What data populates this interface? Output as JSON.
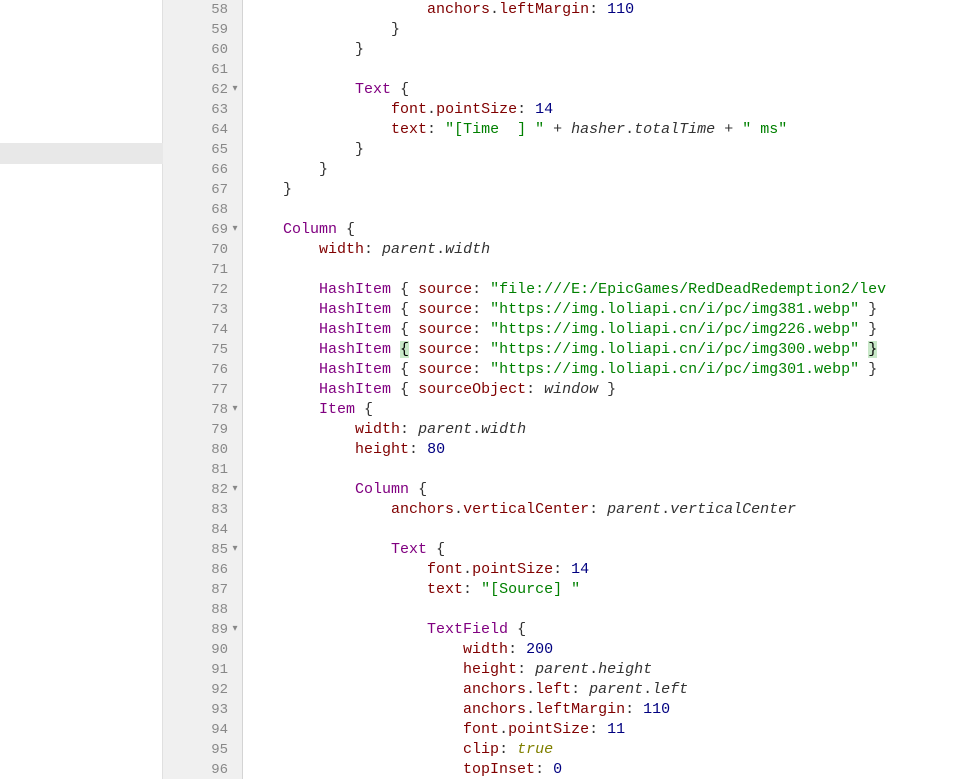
{
  "lines": [
    {
      "num": 58,
      "fold": false,
      "tokens": [
        {
          "t": "sp",
          "v": "                    "
        },
        {
          "t": "prop",
          "v": "anchors"
        },
        {
          "t": "punct",
          "v": "."
        },
        {
          "t": "prop",
          "v": "leftMargin"
        },
        {
          "t": "punct",
          "v": ": "
        },
        {
          "t": "num",
          "v": "110"
        }
      ]
    },
    {
      "num": 59,
      "fold": false,
      "tokens": [
        {
          "t": "sp",
          "v": "                "
        },
        {
          "t": "punct",
          "v": "}"
        }
      ]
    },
    {
      "num": 60,
      "fold": false,
      "tokens": [
        {
          "t": "sp",
          "v": "            "
        },
        {
          "t": "punct",
          "v": "}"
        }
      ]
    },
    {
      "num": 61,
      "fold": false,
      "tokens": []
    },
    {
      "num": 62,
      "fold": true,
      "tokens": [
        {
          "t": "sp",
          "v": "            "
        },
        {
          "t": "type",
          "v": "Text"
        },
        {
          "t": "sp",
          "v": " "
        },
        {
          "t": "punct",
          "v": "{"
        }
      ]
    },
    {
      "num": 63,
      "fold": false,
      "tokens": [
        {
          "t": "sp",
          "v": "                "
        },
        {
          "t": "prop",
          "v": "font"
        },
        {
          "t": "punct",
          "v": "."
        },
        {
          "t": "prop",
          "v": "pointSize"
        },
        {
          "t": "punct",
          "v": ": "
        },
        {
          "t": "num",
          "v": "14"
        }
      ]
    },
    {
      "num": 64,
      "fold": false,
      "tokens": [
        {
          "t": "sp",
          "v": "                "
        },
        {
          "t": "prop",
          "v": "text"
        },
        {
          "t": "punct",
          "v": ": "
        },
        {
          "t": "str",
          "v": "\"[Time  ] \""
        },
        {
          "t": "sp",
          "v": " "
        },
        {
          "t": "op",
          "v": "+"
        },
        {
          "t": "sp",
          "v": " "
        },
        {
          "t": "ident",
          "v": "hasher"
        },
        {
          "t": "punct",
          "v": "."
        },
        {
          "t": "ident",
          "v": "totalTime"
        },
        {
          "t": "sp",
          "v": " "
        },
        {
          "t": "op",
          "v": "+"
        },
        {
          "t": "sp",
          "v": " "
        },
        {
          "t": "str",
          "v": "\" ms\""
        }
      ]
    },
    {
      "num": 65,
      "fold": false,
      "tokens": [
        {
          "t": "sp",
          "v": "            "
        },
        {
          "t": "punct",
          "v": "}"
        }
      ]
    },
    {
      "num": 66,
      "fold": false,
      "tokens": [
        {
          "t": "sp",
          "v": "        "
        },
        {
          "t": "punct",
          "v": "}"
        }
      ]
    },
    {
      "num": 67,
      "fold": false,
      "tokens": [
        {
          "t": "sp",
          "v": "    "
        },
        {
          "t": "punct",
          "v": "}"
        }
      ]
    },
    {
      "num": 68,
      "fold": false,
      "tokens": []
    },
    {
      "num": 69,
      "fold": true,
      "tokens": [
        {
          "t": "sp",
          "v": "    "
        },
        {
          "t": "type",
          "v": "Column"
        },
        {
          "t": "sp",
          "v": " "
        },
        {
          "t": "punct",
          "v": "{"
        }
      ]
    },
    {
      "num": 70,
      "fold": false,
      "tokens": [
        {
          "t": "sp",
          "v": "        "
        },
        {
          "t": "prop",
          "v": "width"
        },
        {
          "t": "punct",
          "v": ": "
        },
        {
          "t": "ident",
          "v": "parent"
        },
        {
          "t": "punct",
          "v": "."
        },
        {
          "t": "ident",
          "v": "width"
        }
      ]
    },
    {
      "num": 71,
      "fold": false,
      "tokens": []
    },
    {
      "num": 72,
      "fold": false,
      "tokens": [
        {
          "t": "sp",
          "v": "        "
        },
        {
          "t": "type",
          "v": "HashItem"
        },
        {
          "t": "sp",
          "v": " "
        },
        {
          "t": "punct",
          "v": "{"
        },
        {
          "t": "sp",
          "v": " "
        },
        {
          "t": "prop",
          "v": "source"
        },
        {
          "t": "punct",
          "v": ": "
        },
        {
          "t": "str",
          "v": "\"file:///E:/EpicGames/RedDeadRedemption2/lev"
        }
      ]
    },
    {
      "num": 73,
      "fold": false,
      "tokens": [
        {
          "t": "sp",
          "v": "        "
        },
        {
          "t": "type",
          "v": "HashItem"
        },
        {
          "t": "sp",
          "v": " "
        },
        {
          "t": "punct",
          "v": "{"
        },
        {
          "t": "sp",
          "v": " "
        },
        {
          "t": "prop",
          "v": "source"
        },
        {
          "t": "punct",
          "v": ": "
        },
        {
          "t": "str",
          "v": "\"https://img.loliapi.cn/i/pc/img381.webp\""
        },
        {
          "t": "sp",
          "v": " "
        },
        {
          "t": "punct",
          "v": "}"
        }
      ]
    },
    {
      "num": 74,
      "fold": false,
      "tokens": [
        {
          "t": "sp",
          "v": "        "
        },
        {
          "t": "type",
          "v": "HashItem"
        },
        {
          "t": "sp",
          "v": " "
        },
        {
          "t": "punct",
          "v": "{"
        },
        {
          "t": "sp",
          "v": " "
        },
        {
          "t": "prop",
          "v": "source"
        },
        {
          "t": "punct",
          "v": ": "
        },
        {
          "t": "str",
          "v": "\"https://img.loliapi.cn/i/pc/img226.webp\""
        },
        {
          "t": "sp",
          "v": " "
        },
        {
          "t": "punct",
          "v": "}"
        }
      ]
    },
    {
      "num": 75,
      "fold": false,
      "current": true,
      "tokens": [
        {
          "t": "sp",
          "v": "        "
        },
        {
          "t": "type",
          "v": "HashItem"
        },
        {
          "t": "sp",
          "v": " "
        },
        {
          "t": "hlpunct",
          "v": "{"
        },
        {
          "t": "sp",
          "v": " "
        },
        {
          "t": "prop",
          "v": "source"
        },
        {
          "t": "punct",
          "v": ": "
        },
        {
          "t": "str",
          "v": "\"https://img.loliapi.cn/i/pc/img300.webp\""
        },
        {
          "t": "sp",
          "v": " "
        },
        {
          "t": "hlpunct",
          "v": "}"
        }
      ]
    },
    {
      "num": 76,
      "fold": false,
      "tokens": [
        {
          "t": "sp",
          "v": "        "
        },
        {
          "t": "type",
          "v": "HashItem"
        },
        {
          "t": "sp",
          "v": " "
        },
        {
          "t": "punct",
          "v": "{"
        },
        {
          "t": "sp",
          "v": " "
        },
        {
          "t": "prop",
          "v": "source"
        },
        {
          "t": "punct",
          "v": ": "
        },
        {
          "t": "str",
          "v": "\"https://img.loliapi.cn/i/pc/img301.webp\""
        },
        {
          "t": "sp",
          "v": " "
        },
        {
          "t": "punct",
          "v": "}"
        }
      ]
    },
    {
      "num": 77,
      "fold": false,
      "tokens": [
        {
          "t": "sp",
          "v": "        "
        },
        {
          "t": "type",
          "v": "HashItem"
        },
        {
          "t": "sp",
          "v": " "
        },
        {
          "t": "punct",
          "v": "{"
        },
        {
          "t": "sp",
          "v": " "
        },
        {
          "t": "prop",
          "v": "sourceObject"
        },
        {
          "t": "punct",
          "v": ": "
        },
        {
          "t": "ident",
          "v": "window"
        },
        {
          "t": "sp",
          "v": " "
        },
        {
          "t": "punct",
          "v": "}"
        }
      ]
    },
    {
      "num": 78,
      "fold": true,
      "tokens": [
        {
          "t": "sp",
          "v": "        "
        },
        {
          "t": "type",
          "v": "Item"
        },
        {
          "t": "sp",
          "v": " "
        },
        {
          "t": "punct",
          "v": "{"
        }
      ]
    },
    {
      "num": 79,
      "fold": false,
      "tokens": [
        {
          "t": "sp",
          "v": "            "
        },
        {
          "t": "prop",
          "v": "width"
        },
        {
          "t": "punct",
          "v": ": "
        },
        {
          "t": "ident",
          "v": "parent"
        },
        {
          "t": "punct",
          "v": "."
        },
        {
          "t": "ident",
          "v": "width"
        }
      ]
    },
    {
      "num": 80,
      "fold": false,
      "tokens": [
        {
          "t": "sp",
          "v": "            "
        },
        {
          "t": "prop",
          "v": "height"
        },
        {
          "t": "punct",
          "v": ": "
        },
        {
          "t": "num",
          "v": "80"
        }
      ]
    },
    {
      "num": 81,
      "fold": false,
      "tokens": []
    },
    {
      "num": 82,
      "fold": true,
      "tokens": [
        {
          "t": "sp",
          "v": "            "
        },
        {
          "t": "type",
          "v": "Column"
        },
        {
          "t": "sp",
          "v": " "
        },
        {
          "t": "punct",
          "v": "{"
        }
      ]
    },
    {
      "num": 83,
      "fold": false,
      "tokens": [
        {
          "t": "sp",
          "v": "                "
        },
        {
          "t": "prop",
          "v": "anchors"
        },
        {
          "t": "punct",
          "v": "."
        },
        {
          "t": "prop",
          "v": "verticalCenter"
        },
        {
          "t": "punct",
          "v": ": "
        },
        {
          "t": "ident",
          "v": "parent"
        },
        {
          "t": "punct",
          "v": "."
        },
        {
          "t": "ident",
          "v": "verticalCenter"
        }
      ]
    },
    {
      "num": 84,
      "fold": false,
      "tokens": []
    },
    {
      "num": 85,
      "fold": true,
      "tokens": [
        {
          "t": "sp",
          "v": "                "
        },
        {
          "t": "type",
          "v": "Text"
        },
        {
          "t": "sp",
          "v": " "
        },
        {
          "t": "punct",
          "v": "{"
        }
      ]
    },
    {
      "num": 86,
      "fold": false,
      "tokens": [
        {
          "t": "sp",
          "v": "                    "
        },
        {
          "t": "prop",
          "v": "font"
        },
        {
          "t": "punct",
          "v": "."
        },
        {
          "t": "prop",
          "v": "pointSize"
        },
        {
          "t": "punct",
          "v": ": "
        },
        {
          "t": "num",
          "v": "14"
        }
      ]
    },
    {
      "num": 87,
      "fold": false,
      "tokens": [
        {
          "t": "sp",
          "v": "                    "
        },
        {
          "t": "prop",
          "v": "text"
        },
        {
          "t": "punct",
          "v": ": "
        },
        {
          "t": "str",
          "v": "\"[Source] \""
        }
      ]
    },
    {
      "num": 88,
      "fold": false,
      "tokens": []
    },
    {
      "num": 89,
      "fold": true,
      "tokens": [
        {
          "t": "sp",
          "v": "                    "
        },
        {
          "t": "type",
          "v": "TextField"
        },
        {
          "t": "sp",
          "v": " "
        },
        {
          "t": "punct",
          "v": "{"
        }
      ]
    },
    {
      "num": 90,
      "fold": false,
      "tokens": [
        {
          "t": "sp",
          "v": "                        "
        },
        {
          "t": "prop",
          "v": "width"
        },
        {
          "t": "punct",
          "v": ": "
        },
        {
          "t": "num",
          "v": "200"
        }
      ]
    },
    {
      "num": 91,
      "fold": false,
      "tokens": [
        {
          "t": "sp",
          "v": "                        "
        },
        {
          "t": "prop",
          "v": "height"
        },
        {
          "t": "punct",
          "v": ": "
        },
        {
          "t": "ident",
          "v": "parent"
        },
        {
          "t": "punct",
          "v": "."
        },
        {
          "t": "ident",
          "v": "height"
        }
      ]
    },
    {
      "num": 92,
      "fold": false,
      "tokens": [
        {
          "t": "sp",
          "v": "                        "
        },
        {
          "t": "prop",
          "v": "anchors"
        },
        {
          "t": "punct",
          "v": "."
        },
        {
          "t": "prop",
          "v": "left"
        },
        {
          "t": "punct",
          "v": ": "
        },
        {
          "t": "ident",
          "v": "parent"
        },
        {
          "t": "punct",
          "v": "."
        },
        {
          "t": "ident",
          "v": "left"
        }
      ]
    },
    {
      "num": 93,
      "fold": false,
      "tokens": [
        {
          "t": "sp",
          "v": "                        "
        },
        {
          "t": "prop",
          "v": "anchors"
        },
        {
          "t": "punct",
          "v": "."
        },
        {
          "t": "prop",
          "v": "leftMargin"
        },
        {
          "t": "punct",
          "v": ": "
        },
        {
          "t": "num",
          "v": "110"
        }
      ]
    },
    {
      "num": 94,
      "fold": false,
      "tokens": [
        {
          "t": "sp",
          "v": "                        "
        },
        {
          "t": "prop",
          "v": "font"
        },
        {
          "t": "punct",
          "v": "."
        },
        {
          "t": "prop",
          "v": "pointSize"
        },
        {
          "t": "punct",
          "v": ": "
        },
        {
          "t": "num",
          "v": "11"
        }
      ]
    },
    {
      "num": 95,
      "fold": false,
      "tokens": [
        {
          "t": "sp",
          "v": "                        "
        },
        {
          "t": "prop",
          "v": "clip"
        },
        {
          "t": "punct",
          "v": ": "
        },
        {
          "t": "kw",
          "v": "true"
        }
      ]
    },
    {
      "num": 96,
      "fold": false,
      "tokens": [
        {
          "t": "sp",
          "v": "                        "
        },
        {
          "t": "prop",
          "v": "topInset"
        },
        {
          "t": "punct",
          "v": ": "
        },
        {
          "t": "num",
          "v": "0"
        }
      ]
    }
  ],
  "fold_marker": "▾"
}
